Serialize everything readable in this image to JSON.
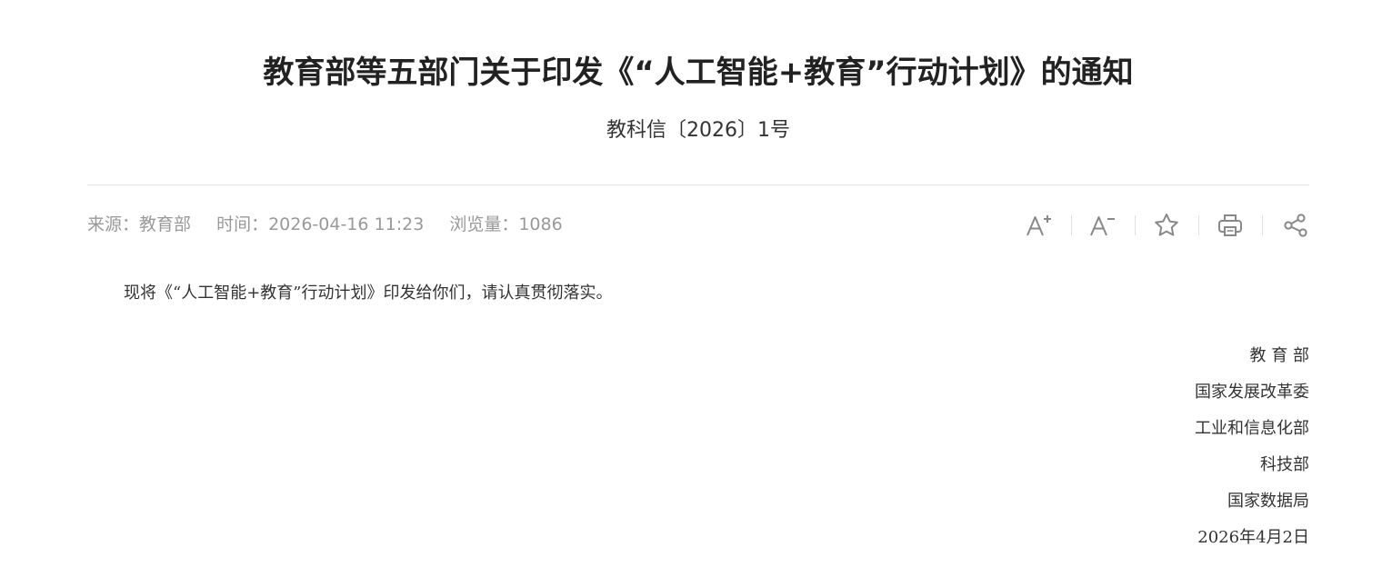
{
  "article": {
    "title": "教育部等五部门关于印发《“人工智能+教育”行动计划》的通知",
    "doc_number": "教科信〔2026〕1号",
    "meta": {
      "source": "来源：教育部",
      "time": "时间：2026-04-16 11:23",
      "views": "浏览量：1086"
    },
    "body": "现将《“人工智能+教育”行动计划》印发给你们，请认真贯彻落实。",
    "signers": [
      "教 育 部",
      "国家发展改革委",
      "工业和信息化部",
      "科技部",
      "国家数据局"
    ],
    "date": "2026年4月2日"
  },
  "toolbar": {
    "icons": [
      "font-increase-icon",
      "font-decrease-icon",
      "star-icon",
      "print-icon",
      "share-icon"
    ],
    "icon_color": "#888888"
  }
}
